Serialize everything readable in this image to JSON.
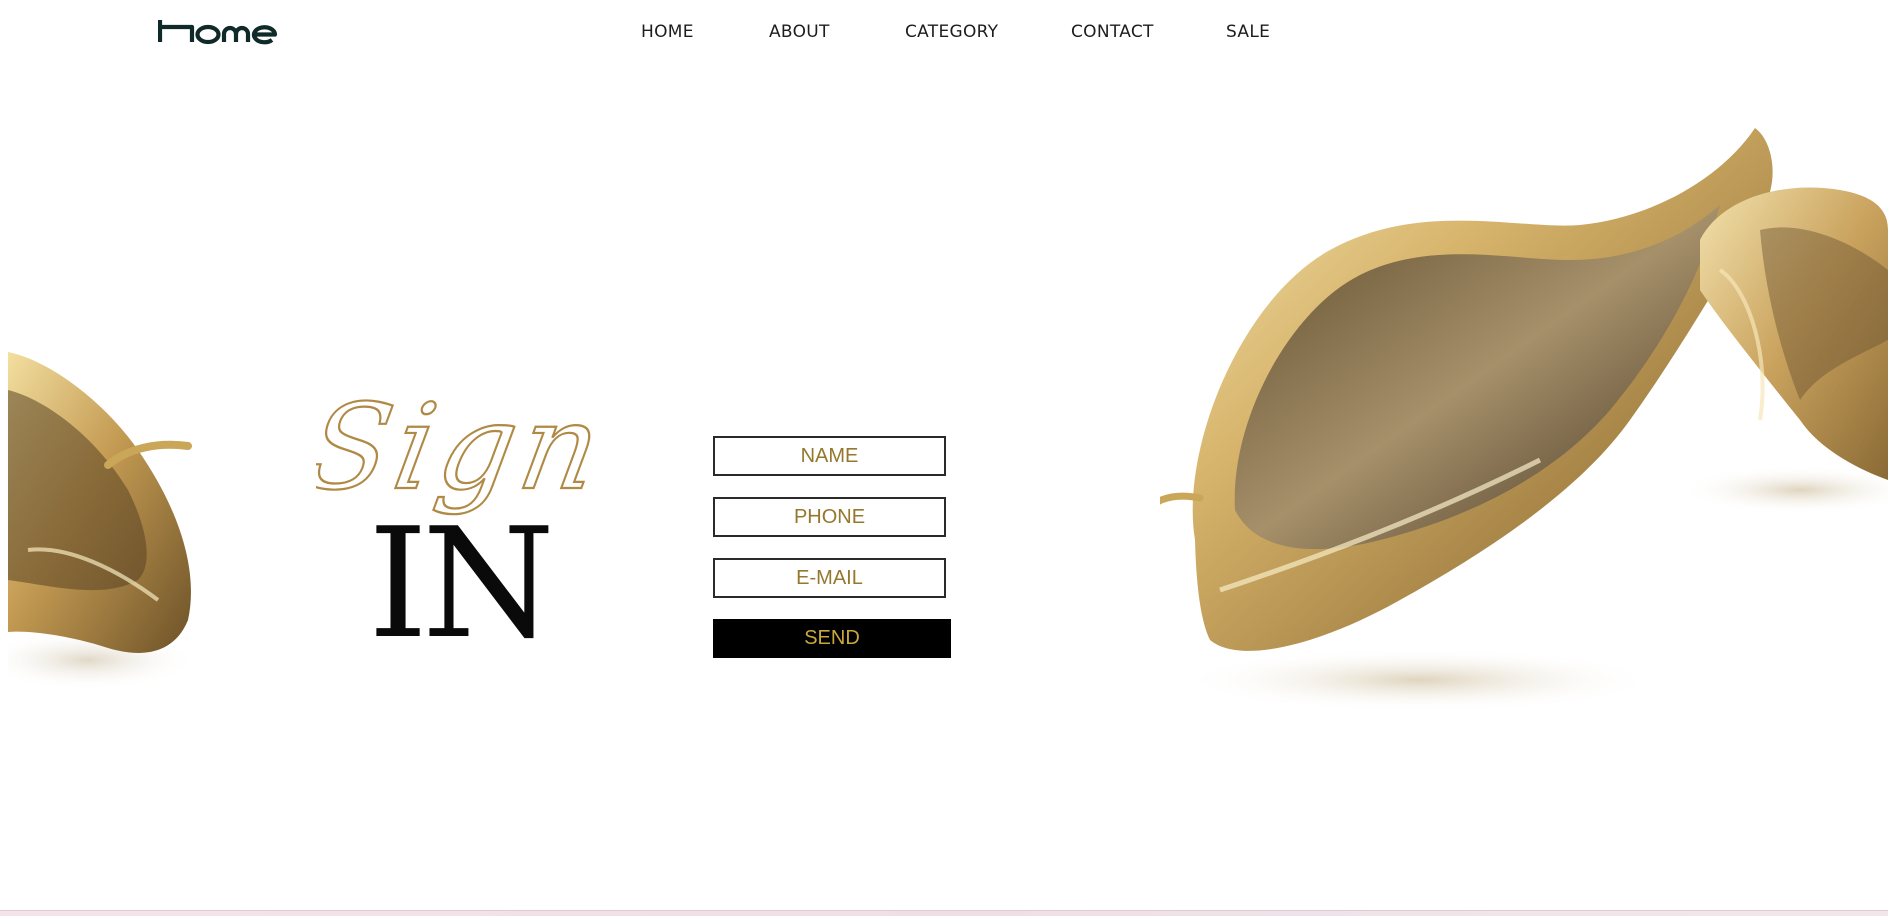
{
  "logo": {
    "text": "home"
  },
  "nav": {
    "items": [
      {
        "label": "HOME"
      },
      {
        "label": "ABOUT"
      },
      {
        "label": "CATEGORY"
      },
      {
        "label": "CONTACT"
      },
      {
        "label": "SALE"
      }
    ]
  },
  "hero": {
    "script_word": "Sign",
    "title": "IN"
  },
  "form": {
    "name_placeholder": "NAME",
    "phone_placeholder": "PHONE",
    "email_placeholder": "E-MAIL",
    "send_label": "SEND"
  },
  "colors": {
    "accent_gold": "#94782d",
    "button_text_gold": "#c9a93c",
    "logo_dark": "#0f2a28",
    "button_bg": "#000000"
  }
}
